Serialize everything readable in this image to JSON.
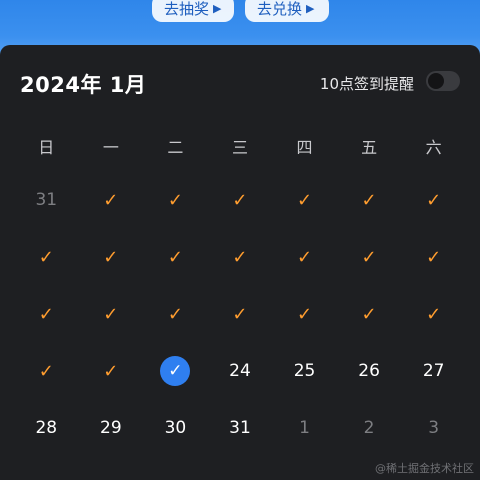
{
  "banner": {
    "lottery_label": "去抽奖",
    "exchange_label": "去兑换",
    "arrow_icon": "triangle-right-icon"
  },
  "calendar": {
    "month_title": "2024年 1月",
    "reminder_label": "10点签到提醒",
    "reminder_enabled": false,
    "weekdays": [
      "日",
      "一",
      "二",
      "三",
      "四",
      "五",
      "六"
    ],
    "rows": [
      [
        {
          "text": "31",
          "state": "muted"
        },
        {
          "text": "",
          "state": "checked"
        },
        {
          "text": "",
          "state": "checked"
        },
        {
          "text": "",
          "state": "checked"
        },
        {
          "text": "",
          "state": "checked"
        },
        {
          "text": "",
          "state": "checked"
        },
        {
          "text": "",
          "state": "checked"
        }
      ],
      [
        {
          "text": "",
          "state": "checked"
        },
        {
          "text": "",
          "state": "checked"
        },
        {
          "text": "",
          "state": "checked"
        },
        {
          "text": "",
          "state": "checked"
        },
        {
          "text": "",
          "state": "checked"
        },
        {
          "text": "",
          "state": "checked"
        },
        {
          "text": "",
          "state": "checked"
        }
      ],
      [
        {
          "text": "",
          "state": "checked"
        },
        {
          "text": "",
          "state": "checked"
        },
        {
          "text": "",
          "state": "checked"
        },
        {
          "text": "",
          "state": "checked"
        },
        {
          "text": "",
          "state": "checked"
        },
        {
          "text": "",
          "state": "checked"
        },
        {
          "text": "",
          "state": "checked"
        }
      ],
      [
        {
          "text": "",
          "state": "checked"
        },
        {
          "text": "",
          "state": "checked"
        },
        {
          "text": "",
          "state": "today-checked"
        },
        {
          "text": "24",
          "state": "normal"
        },
        {
          "text": "25",
          "state": "normal"
        },
        {
          "text": "26",
          "state": "normal"
        },
        {
          "text": "27",
          "state": "normal"
        }
      ],
      [
        {
          "text": "28",
          "state": "normal"
        },
        {
          "text": "29",
          "state": "normal"
        },
        {
          "text": "30",
          "state": "normal"
        },
        {
          "text": "31",
          "state": "normal"
        },
        {
          "text": "1",
          "state": "muted"
        },
        {
          "text": "2",
          "state": "muted"
        },
        {
          "text": "3",
          "state": "muted"
        }
      ]
    ]
  },
  "colors": {
    "check": "#ff9d2f",
    "today": "#2f7ff0",
    "panel": "#1e1f22"
  },
  "watermark": "@稀土掘金技术社区"
}
